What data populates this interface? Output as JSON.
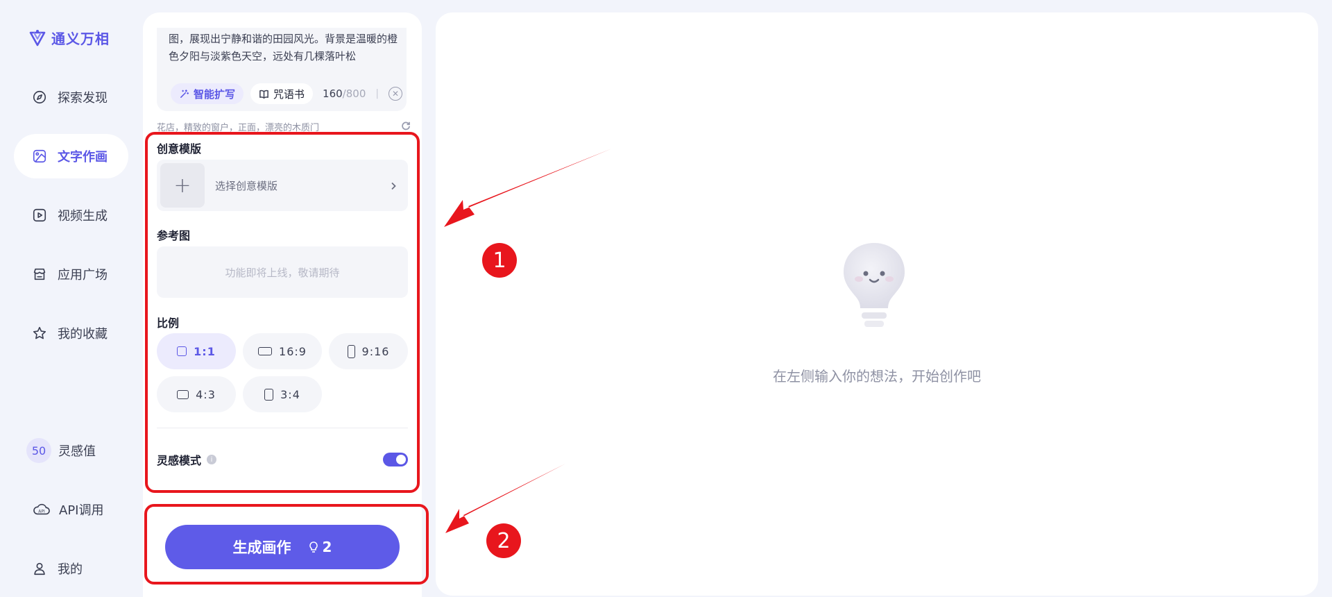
{
  "app": {
    "brand": "通义万相"
  },
  "sidebar": {
    "items": [
      {
        "label": "探索发现",
        "icon": "compass-icon"
      },
      {
        "label": "文字作画",
        "icon": "image-icon",
        "active": true
      },
      {
        "label": "视频生成",
        "icon": "video-play-icon"
      },
      {
        "label": "应用广场",
        "icon": "store-icon"
      },
      {
        "label": "我的收藏",
        "icon": "star-icon"
      }
    ],
    "points": {
      "value": "50",
      "label": "灵感值"
    },
    "api": {
      "label": "API调用",
      "icon": "api-cloud-icon"
    },
    "profile": {
      "label": "我的",
      "icon": "user-icon"
    }
  },
  "form": {
    "prompt_text": "图，展现出宁静和谐的田园风光。背景是温暖的橙色夕阳与淡紫色天空，远处有几棵落叶松",
    "smart_expand_label": "智能扩写",
    "spell_book_label": "咒语书",
    "char_count": "160",
    "char_max": "/800",
    "char_separator": "|",
    "suggestion": "花店，精致的窗户，正面，漂亮的木质门",
    "template_title": "创意模版",
    "template_placeholder": "选择创意模版",
    "template_add": "+",
    "reference_title": "参考图",
    "reference_placeholder": "功能即将上线，敬请期待",
    "ratio_title": "比例",
    "ratios": [
      {
        "label": "1:1",
        "selected": true
      },
      {
        "label": "16:9",
        "selected": false
      },
      {
        "label": "9:16",
        "selected": false
      },
      {
        "label": "4:3",
        "selected": false
      },
      {
        "label": "3:4",
        "selected": false
      }
    ],
    "inspire_label": "灵感模式",
    "inspire_info": "i",
    "inspire_enabled": true,
    "generate_label": "生成画作",
    "generate_cost": "2"
  },
  "preview": {
    "empty_text": "在左侧输入你的想法，开始创作吧"
  },
  "annotations": {
    "badge_1": "1",
    "badge_2": "2",
    "color": "#e8161d"
  },
  "colors": {
    "accent": "#5b57e6",
    "background": "#f2f4fb"
  }
}
